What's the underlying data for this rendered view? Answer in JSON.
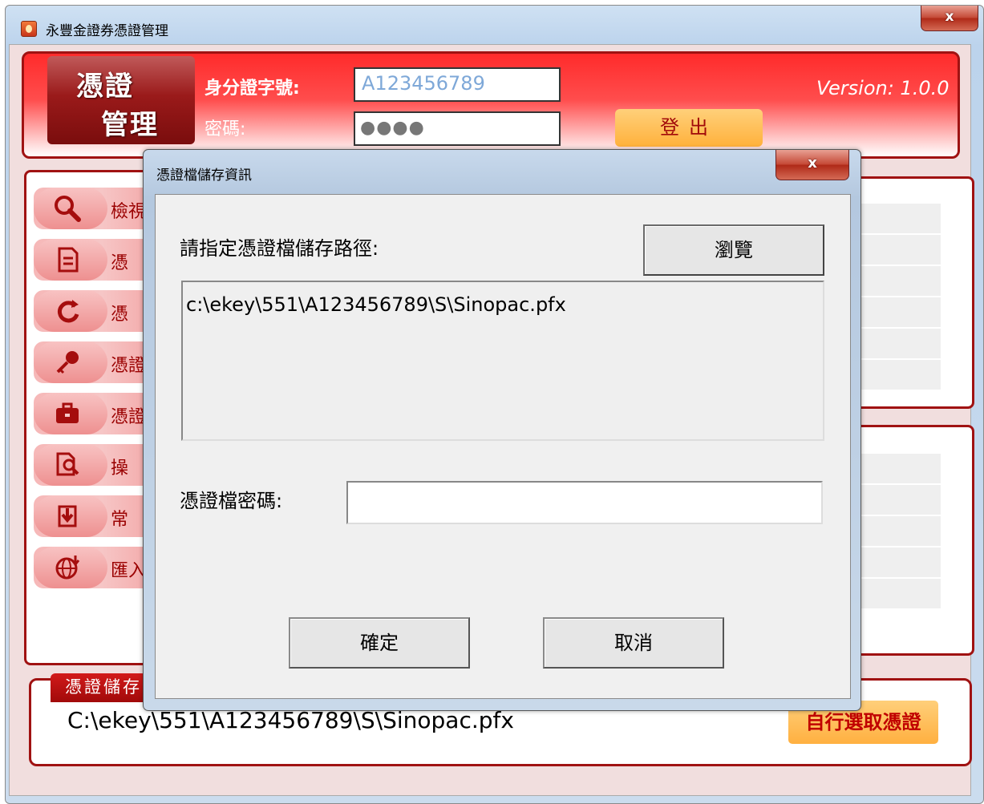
{
  "app": {
    "title": "永豐金證券憑證管理",
    "close_glyph": "x"
  },
  "header": {
    "logo_line1": "憑證",
    "logo_line2": "管理",
    "id_label": "身分證字號:",
    "id_value": "A123456789",
    "password_label": "密碼:",
    "password_mask": "●●●●",
    "logout_label": "登出",
    "version": "Version: 1.0.0"
  },
  "menu": {
    "items": [
      {
        "label": "檢視",
        "icon": "magnifier-icon"
      },
      {
        "label": "憑",
        "icon": "document-icon"
      },
      {
        "label": "憑",
        "icon": "refresh-icon"
      },
      {
        "label": "憑證",
        "icon": "key-icon"
      },
      {
        "label": "憑證",
        "icon": "briefcase-icon"
      },
      {
        "label": "操",
        "icon": "search-document-icon"
      },
      {
        "label": "常",
        "icon": "download-icon"
      },
      {
        "label": "匯入",
        "icon": "globe-icon"
      }
    ]
  },
  "storage": {
    "tab_label": "憑證儲存",
    "path": "C:\\ekey\\551\\A123456789\\S\\Sinopac.pfx",
    "choose_button": "自行選取憑證"
  },
  "dialog": {
    "title": "憑證檔儲存資訊",
    "close_glyph": "x",
    "path_prompt": "請指定憑證檔儲存路徑:",
    "browse_label": "瀏覽",
    "path_value": "c:\\ekey\\551\\A123456789\\S\\Sinopac.pfx",
    "password_prompt": "憑證檔密碼:",
    "password_value": "",
    "ok_label": "確定",
    "cancel_label": "取消"
  }
}
